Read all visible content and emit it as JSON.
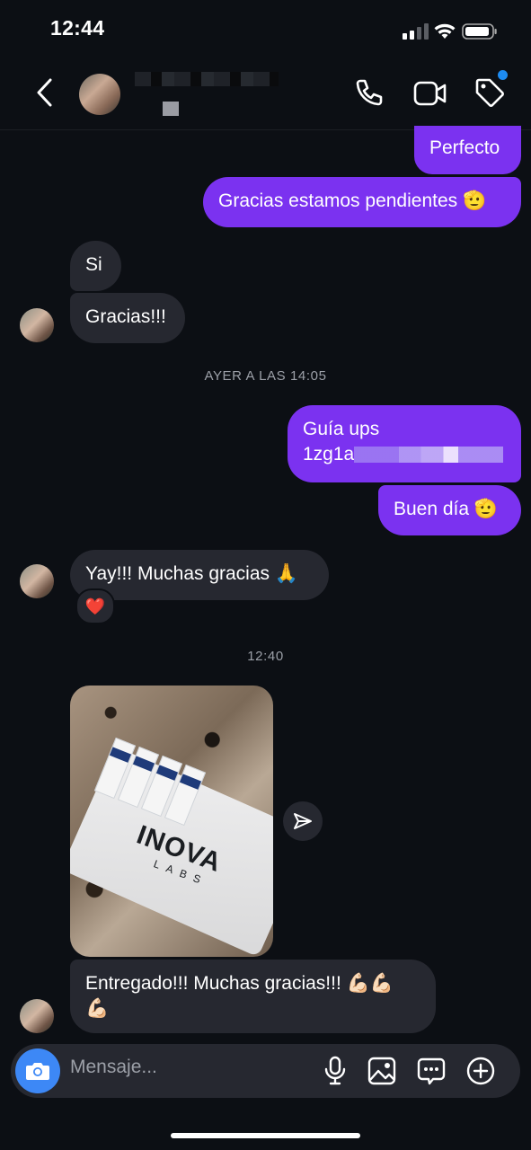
{
  "status_bar": {
    "time": "12:44"
  },
  "header": {
    "back_icon": "chevron-left-icon",
    "call_icon": "phone-icon",
    "video_icon": "video-camera-icon",
    "tag_icon": "tag-icon",
    "notification_color": "#1d8bf1"
  },
  "messages": {
    "m1": "Perfecto",
    "m2": "Gracias estamos pendientes",
    "m2_emoji": "🫡",
    "m3": "Si",
    "m4": "Gracias!!!",
    "timestamp1": "AYER A LAS 14:05",
    "m5_line1": "Guía ups",
    "m5_line2_start": "1zg1a",
    "m6": "Buen día",
    "m6_emoji": "🫡",
    "m7": "Yay!!! Muchas gracias",
    "m7_emoji": "🙏",
    "reaction": "❤️",
    "timestamp2": "12:40",
    "photo_logo": "INOVA",
    "photo_logo_sub": "LABS",
    "m8_line1": "Entregado!!! Muchas gracias!!!",
    "m8_line1_emoji": "💪🏻💪🏻",
    "m8_line2_emoji": "💪🏻"
  },
  "composer": {
    "placeholder": "Mensaje...",
    "camera_icon": "camera-icon",
    "mic_icon": "microphone-icon",
    "gallery_icon": "image-icon",
    "sticker_icon": "chat-bubble-icon",
    "plus_icon": "plus-circle-icon"
  },
  "colors": {
    "outgoing": "#7b32f0",
    "incoming": "#262830",
    "background": "#0c0f14",
    "camera_button": "#3d88f6"
  }
}
